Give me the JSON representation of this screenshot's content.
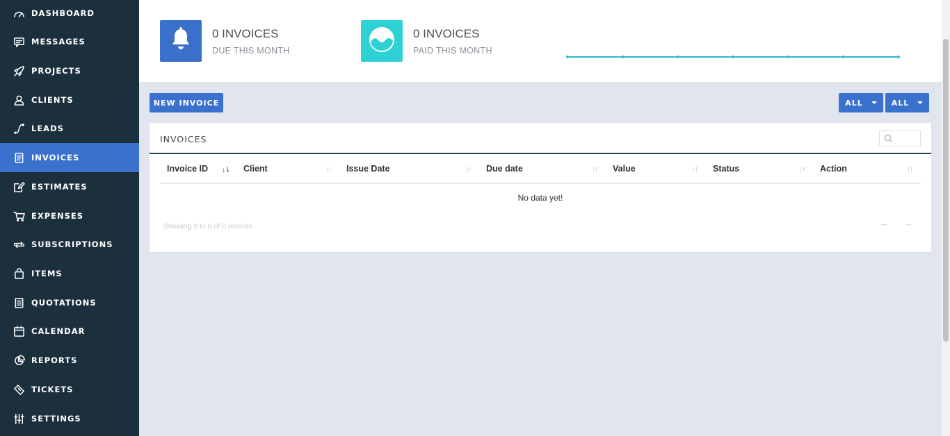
{
  "sidebar": {
    "items": [
      {
        "label": "DASHBOARD",
        "icon": "gauge-icon"
      },
      {
        "label": "MESSAGES",
        "icon": "message-icon"
      },
      {
        "label": "PROJECTS",
        "icon": "rocket-icon"
      },
      {
        "label": "CLIENTS",
        "icon": "user-icon"
      },
      {
        "label": "LEADS",
        "icon": "leads-icon"
      },
      {
        "label": "INVOICES",
        "icon": "invoice-icon",
        "active": true
      },
      {
        "label": "ESTIMATES",
        "icon": "edit-icon"
      },
      {
        "label": "EXPENSES",
        "icon": "cart-icon"
      },
      {
        "label": "SUBSCRIPTIONS",
        "icon": "repeat-icon"
      },
      {
        "label": "ITEMS",
        "icon": "bag-icon"
      },
      {
        "label": "QUOTATIONS",
        "icon": "document-icon"
      },
      {
        "label": "CALENDAR",
        "icon": "calendar-icon"
      },
      {
        "label": "REPORTS",
        "icon": "pie-icon"
      },
      {
        "label": "TICKETS",
        "icon": "ticket-icon"
      },
      {
        "label": "SETTINGS",
        "icon": "sliders-icon"
      }
    ]
  },
  "stats": {
    "due": {
      "title": "0 INVOICES",
      "subtitle": "DUE THIS MONTH",
      "color": "#3a6fca",
      "icon": "bell-icon"
    },
    "paid": {
      "title": "0 INVOICES",
      "subtitle": "PAID THIS MONTH",
      "color": "#2ed2d4",
      "icon": "wave-icon"
    }
  },
  "sparkline": {
    "color": "#2cb8c8",
    "values": [
      0,
      0,
      0,
      0,
      0,
      0,
      0
    ]
  },
  "toolbar": {
    "new_invoice_label": "NEW INVOICE",
    "filter1_label": "ALL",
    "filter2_label": "ALL"
  },
  "panel": {
    "title": "INVOICES",
    "search_placeholder": "",
    "columns": [
      "Invoice ID",
      "Client",
      "Issue Date",
      "Due date",
      "Value",
      "Status",
      "Action"
    ],
    "empty_text": "No data yet!",
    "showing_text": "Showing 0 to 0 of 0 records",
    "prev_label": "←",
    "next_label": "→"
  },
  "colors": {
    "accent": "#3a71ce",
    "sidebar": "#1b2f3d",
    "background": "#e1e5ee"
  }
}
